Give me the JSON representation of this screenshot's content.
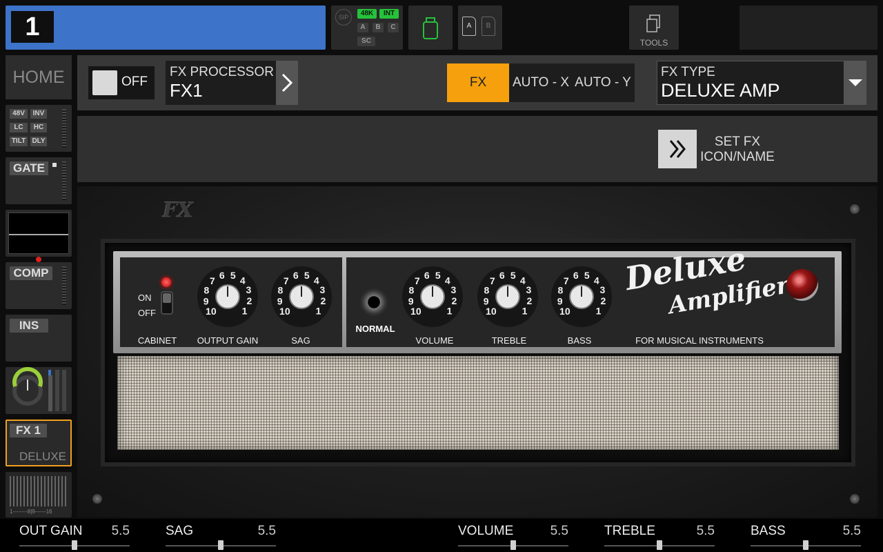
{
  "top_bar": {
    "channel_number": "1",
    "sip_label": "SIP",
    "status_chips": {
      "rate": "48K",
      "clock": "INT",
      "a": "A",
      "b": "B",
      "c": "C",
      "sc": "SC"
    },
    "card_a": "A",
    "card_b": "B",
    "tools_label": "TOOLS"
  },
  "sidebar": {
    "home_label": "HOME",
    "preamp_chips": [
      "48V",
      "INV",
      "LC",
      "HC",
      "TILT",
      "DLY"
    ],
    "gate_label": "GATE",
    "comp_label": "COMP",
    "ins_label": "INS",
    "fx_slot_label": "FX 1",
    "fx_slot_type": "DELUXE",
    "bus_scale": "1--------8|9------16"
  },
  "header": {
    "onoff_label": "OFF",
    "fx_processor_title": "FX PROCESSOR",
    "fx_processor_value": "FX1",
    "mode_fx": "FX",
    "mode_auto_x": "AUTO - X",
    "mode_auto_y": "AUTO - Y",
    "fx_type_title": "FX TYPE",
    "fx_type_value": "DELUXE AMP"
  },
  "set_fx": {
    "label_line1": "SET FX",
    "label_line2": "ICON/NAME"
  },
  "amp": {
    "logo": "FX",
    "cabinet_on": "ON",
    "cabinet_off": "OFF",
    "cabinet_label": "CABINET",
    "knob_labels": [
      "OUTPUT GAIN",
      "SAG",
      "VOLUME",
      "TREBLE",
      "BASS"
    ],
    "normal_label": "NORMAL",
    "brand_line1": "Deluxe",
    "brand_line2": "Amplifier",
    "tagline": "FOR MUSICAL INSTRUMENTS",
    "dial_numbers": [
      "1",
      "2",
      "3",
      "4",
      "5",
      "6",
      "7",
      "8",
      "9",
      "10"
    ]
  },
  "params": [
    {
      "name": "OUT GAIN",
      "value": "5.5",
      "fraction": 0.5
    },
    {
      "name": "SAG",
      "value": "5.5",
      "fraction": 0.5
    },
    {
      "name": "VOLUME",
      "value": "5.5",
      "fraction": 0.5
    },
    {
      "name": "TREBLE",
      "value": "5.5",
      "fraction": 0.5
    },
    {
      "name": "BASS",
      "value": "5.5",
      "fraction": 0.5
    }
  ],
  "colors": {
    "channel_blue": "#3d73c8",
    "fx_active_orange": "#f5a00c",
    "status_green": "#27c23b",
    "selected_border": "#f0a020"
  }
}
